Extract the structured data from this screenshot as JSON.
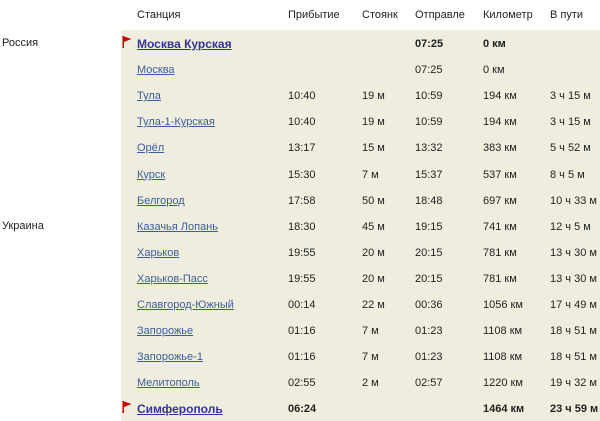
{
  "columns": {
    "station": "Станция",
    "arrive": "Прибытие",
    "stop": "Стоянк",
    "depart": "Отправле",
    "km": "Километр",
    "travel": "В пути"
  },
  "colors": {
    "row_background": "#efeede",
    "link": "#3b5d9c",
    "bold_link": "#333399",
    "flag": "#cc0000"
  },
  "rows": [
    {
      "country": "Россия",
      "flag": true,
      "bold": true,
      "station": "Москва Курская",
      "arrive": "",
      "stop": "",
      "depart": "07:25",
      "km": "0 км",
      "travel": ""
    },
    {
      "country": "",
      "flag": false,
      "bold": false,
      "station": "Москва",
      "arrive": "",
      "stop": "",
      "depart": "07:25",
      "km": "0 км",
      "travel": ""
    },
    {
      "country": "",
      "flag": false,
      "bold": false,
      "station": "Тула",
      "arrive": "10:40",
      "stop": "19 м",
      "depart": "10:59",
      "km": "194 км",
      "travel": "3 ч 15 м"
    },
    {
      "country": "",
      "flag": false,
      "bold": false,
      "station": "Тула-1-Курская",
      "arrive": "10:40",
      "stop": "19 м",
      "depart": "10:59",
      "km": "194 км",
      "travel": "3 ч 15 м"
    },
    {
      "country": "",
      "flag": false,
      "bold": false,
      "station": "Орёл",
      "arrive": "13:17",
      "stop": "15 м",
      "depart": "13:32",
      "km": "383 км",
      "travel": "5 ч 52 м"
    },
    {
      "country": "",
      "flag": false,
      "bold": false,
      "station": "Курск",
      "arrive": "15:30",
      "stop": "7 м",
      "depart": "15:37",
      "km": "537 км",
      "travel": "8 ч 5 м"
    },
    {
      "country": "",
      "flag": false,
      "bold": false,
      "station": "Белгород",
      "arrive": "17:58",
      "stop": "50 м",
      "depart": "18:48",
      "km": "697 км",
      "travel": "10 ч 33 м"
    },
    {
      "country": "Украина",
      "flag": false,
      "bold": false,
      "station": "Казачья Лопань",
      "arrive": "18:30",
      "stop": "45 м",
      "depart": "19:15",
      "km": "741 км",
      "travel": "12 ч 5 м"
    },
    {
      "country": "",
      "flag": false,
      "bold": false,
      "station": "Харьков",
      "arrive": "19:55",
      "stop": "20 м",
      "depart": "20:15",
      "km": "781 км",
      "travel": "13 ч 30 м"
    },
    {
      "country": "",
      "flag": false,
      "bold": false,
      "station": "Харьков-Пасс",
      "arrive": "19:55",
      "stop": "20 м",
      "depart": "20:15",
      "km": "781 км",
      "travel": "13 ч 30 м"
    },
    {
      "country": "",
      "flag": false,
      "bold": false,
      "station": "Славгород-Южный",
      "arrive": "00:14",
      "stop": "22 м",
      "depart": "00:36",
      "km": "1056 км",
      "travel": "17 ч 49 м"
    },
    {
      "country": "",
      "flag": false,
      "bold": false,
      "station": "Запорожье",
      "arrive": "01:16",
      "stop": "7 м",
      "depart": "01:23",
      "km": "1108 км",
      "travel": "18 ч 51 м"
    },
    {
      "country": "",
      "flag": false,
      "bold": false,
      "station": "Запорожье-1",
      "arrive": "01:16",
      "stop": "7 м",
      "depart": "01:23",
      "km": "1108 км",
      "travel": "18 ч 51 м"
    },
    {
      "country": "",
      "flag": false,
      "bold": false,
      "station": "Мелитополь",
      "arrive": "02:55",
      "stop": "2 м",
      "depart": "02:57",
      "km": "1220 км",
      "travel": "19 ч 32 м"
    },
    {
      "country": "",
      "flag": true,
      "bold": true,
      "station": "Симферополь",
      "arrive": "06:24",
      "stop": "",
      "depart": "",
      "km": "1464 км",
      "travel": "23 ч 59 м"
    }
  ]
}
